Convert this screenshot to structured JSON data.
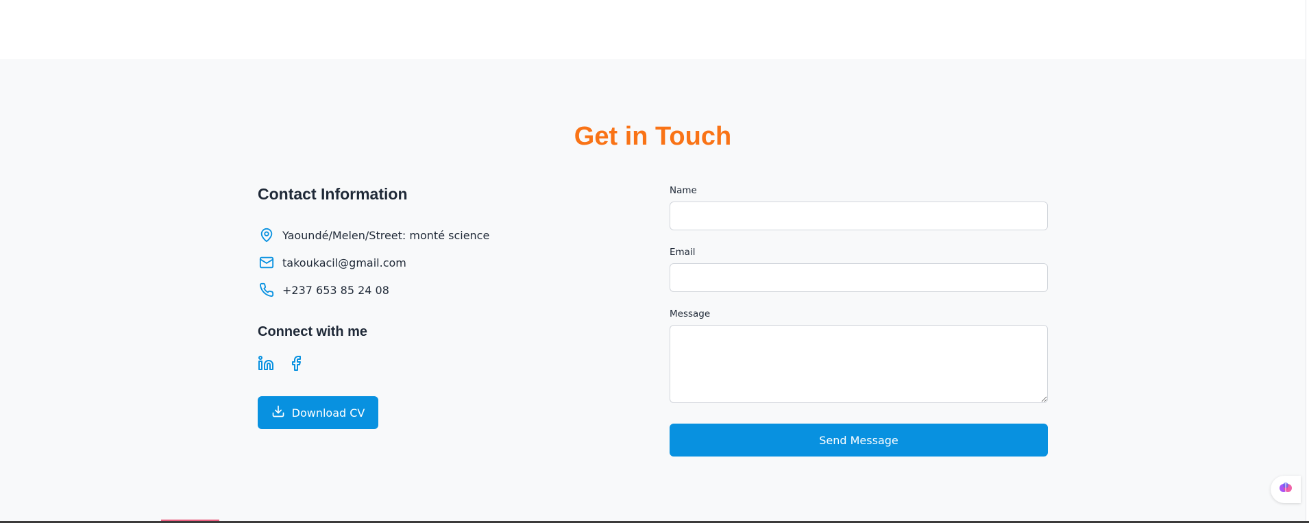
{
  "section": {
    "title": "Get in Touch"
  },
  "contact": {
    "heading": "Contact Information",
    "items": [
      {
        "icon": "map-pin-icon",
        "text": "Yaoundé/Melen/Street: monté science"
      },
      {
        "icon": "mail-icon",
        "text": "takoukacil@gmail.com"
      },
      {
        "icon": "phone-icon",
        "text": "+237 653 85 24 08"
      }
    ],
    "connect_heading": "Connect with me",
    "socials": [
      {
        "icon": "linkedin-icon"
      },
      {
        "icon": "facebook-icon"
      }
    ],
    "download_label": "Download CV"
  },
  "form": {
    "name_label": "Name",
    "name_value": "",
    "email_label": "Email",
    "email_value": "",
    "message_label": "Message",
    "message_value": "",
    "send_label": "Send Message"
  },
  "colors": {
    "accent": "#f97316",
    "primary": "#0891e0",
    "background": "#f8f9fa"
  }
}
